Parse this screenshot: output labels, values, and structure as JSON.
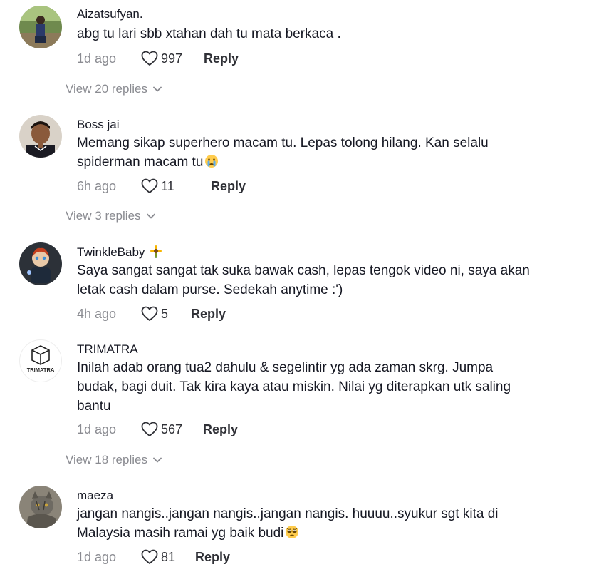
{
  "reply_label": "Reply",
  "comments": [
    {
      "username": "Aizatsufyan.",
      "text": "abg tu lari sbb xtahan dah tu mata berkaca .",
      "time": "1d ago",
      "likes": "997",
      "view_replies": "View 20 replies"
    },
    {
      "username": "Boss jai",
      "text": "Memang sikap superhero macam tu. Lepas tolong hilang. Kan selalu spiderman macam tu",
      "time": "6h ago",
      "likes": "11",
      "view_replies": "View 3 replies"
    },
    {
      "username": "TwinkleBaby",
      "text": "Saya sangat sangat tak suka bawak cash, lepas tengok video ni, saya akan letak cash dalam purse. Sedekah anytime :')",
      "time": "4h ago",
      "likes": "5"
    },
    {
      "username": "TRIMATRA",
      "text": "Inilah adab orang tua2 dahulu & segelintir yg ada zaman skrg. Jumpa budak, bagi duit. Tak kira kaya atau miskin. Nilai yg diterapkan utk saling bantu",
      "time": "1d ago",
      "likes": "567",
      "view_replies": "View 18 replies",
      "avatar_logo_text": "TRIMATRA"
    },
    {
      "username": "maeza",
      "text": "jangan nangis..jangan nangis..jangan nangis. huuuu..syukur sgt kita di Malaysia masih ramai yg baik budi",
      "time": "1d ago",
      "likes": "81"
    }
  ],
  "icons": {
    "like": "heart-outline-icon",
    "expand": "chevron-down-icon",
    "crying": "crying-face-emoji",
    "pleading": "pleading-face-emoji",
    "badge": "sunflower-emoji"
  },
  "colors": {
    "text": "#161823",
    "muted": "#8a8b91",
    "action": "#2f3036"
  }
}
